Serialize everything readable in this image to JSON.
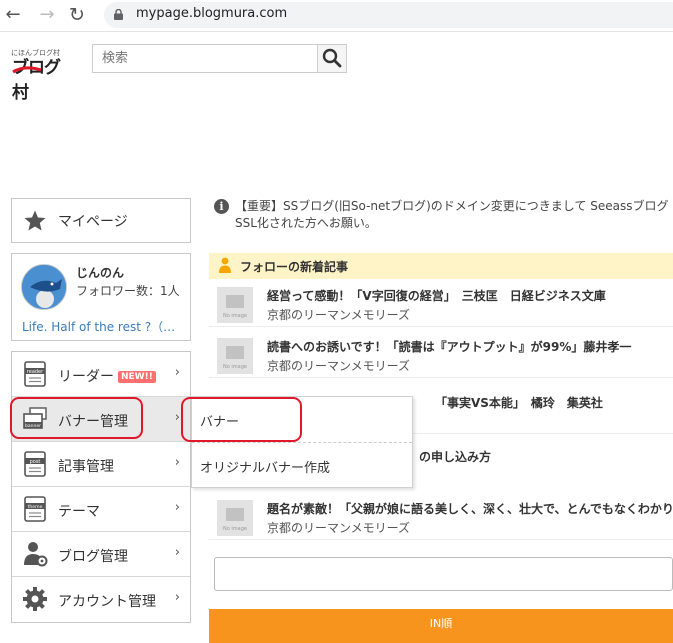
{
  "browser": {
    "back_glyph": "←",
    "forward_glyph": "→",
    "reload_glyph": "↻",
    "url": "mypage.blogmura.com"
  },
  "header": {
    "logo_small": "にほんブログ村",
    "logo_text": "ブログ村",
    "search_placeholder": "検索"
  },
  "sidebar": {
    "mypage_label": "マイページ",
    "profile": {
      "name": "じんのん",
      "followers": "フォロワー数：1人",
      "description": "Life. Half of the rest ?（…"
    },
    "menu": [
      {
        "label": "リーダー",
        "badge": "NEW!!",
        "icon": "reader-icon",
        "chevron": "›"
      },
      {
        "label": "バナー管理",
        "icon": "banner-icon",
        "chevron": "›",
        "active": true
      },
      {
        "label": "記事管理",
        "icon": "post-icon",
        "chevron": "›"
      },
      {
        "label": "テーマ",
        "icon": "theme-icon",
        "chevron": "›"
      },
      {
        "label": "ブログ管理",
        "icon": "person-gear-icon",
        "chevron": "›"
      },
      {
        "label": "アカウント管理",
        "icon": "gear-icon",
        "chevron": "›"
      }
    ]
  },
  "submenu": {
    "items": [
      "バナー",
      "オリジナルバナー作成"
    ]
  },
  "main": {
    "notice": "【重要】SSブログ(旧So-netブログ)のドメイン変更につきまして Seeassブログ SSL化された方へお願い。",
    "follow_title": "フォローの新着記事",
    "articles": [
      {
        "title": "経営って感動！「V字回復の経営」　三枝匡　日経ビジネス文庫",
        "source": "京都のリーマンメモリーズ"
      },
      {
        "title": "読書へのお誘いです！「読書は『アウトプット』が99%」藤井孝一",
        "source": "京都のリーマンメモリーズ"
      },
      {
        "title": "「事実VS本能」　橘玲　集英社",
        "source": ""
      },
      {
        "title": "の申し込み方",
        "source": ""
      },
      {
        "title": "題名が素敵！「父親が娘に語る美しく、深く、壮大で、とんでもなくわかりやすい",
        "source": "京都のリーマンメモリーズ"
      }
    ],
    "no_image": "No image",
    "in_bar": "IN順"
  },
  "colors": {
    "highlight": "#e0192a",
    "follow_header_bg": "#fff4c8",
    "in_bar": "#f7941d",
    "link": "#3a7bb8"
  }
}
